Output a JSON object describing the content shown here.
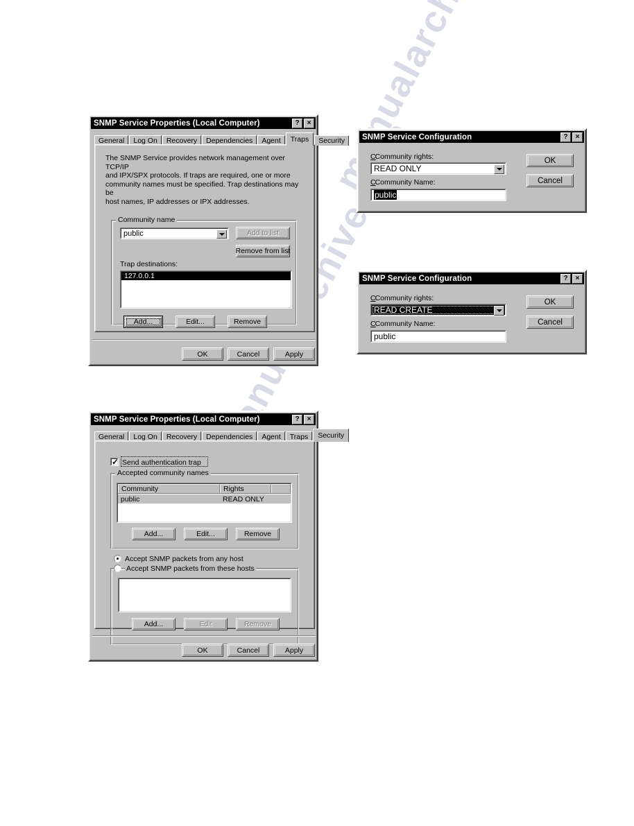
{
  "watermark": {
    "text1": "manualarchive.com",
    "text2": "manualarchive.com"
  },
  "traps_dialog": {
    "title": "SNMP Service Properties (Local Computer)",
    "titlebar_help": "?",
    "titlebar_close": "×",
    "tabs": [
      {
        "label": "General",
        "active": false
      },
      {
        "label": "Log On",
        "active": false
      },
      {
        "label": "Recovery",
        "active": false
      },
      {
        "label": "Dependencies",
        "active": false
      },
      {
        "label": "Agent",
        "active": false
      },
      {
        "label": "Traps",
        "active": true
      },
      {
        "label": "Security",
        "active": false
      }
    ],
    "description_lines": [
      "The SNMP Service provides network management over TCP/IP",
      "and IPX/SPX protocols. If traps are required, one or more",
      "community names must be specified. Trap destinations may be",
      "host names, IP addresses or IPX addresses."
    ],
    "community_group_label": "Community name",
    "community_value": "public",
    "add_to_list_label": "Add to list",
    "add_to_list_disabled": true,
    "remove_from_list_label": "Remove from list",
    "trap_destinations_label": "Trap destinations:",
    "trap_destinations": [
      "127.0.0.1"
    ],
    "add_label": "Add...",
    "edit_label": "Edit...",
    "remove_label": "Remove",
    "ok_label": "OK",
    "cancel_label": "Cancel",
    "apply_label": "Apply"
  },
  "config_dialog_1": {
    "title": "SNMP Service Configuration",
    "titlebar_help": "?",
    "titlebar_close": "×",
    "community_rights_label": "Community rights:",
    "community_rights_value": "READ ONLY",
    "community_name_label": "Community Name:",
    "community_name_value": "public",
    "community_name_selected": true,
    "ok_label": "OK",
    "cancel_label": "Cancel"
  },
  "config_dialog_2": {
    "title": "SNMP Service Configuration",
    "titlebar_help": "?",
    "titlebar_close": "×",
    "community_rights_label": "Community rights:",
    "community_rights_value": "READ CREATE",
    "community_rights_focused": true,
    "community_name_label": "Community Name:",
    "community_name_value": "public",
    "ok_label": "OK",
    "cancel_label": "Cancel"
  },
  "security_dialog": {
    "title": "SNMP Service Properties (Local Computer)",
    "titlebar_help": "?",
    "titlebar_close": "×",
    "tabs": [
      {
        "label": "General",
        "active": false
      },
      {
        "label": "Log On",
        "active": false
      },
      {
        "label": "Recovery",
        "active": false
      },
      {
        "label": "Dependencies",
        "active": false
      },
      {
        "label": "Agent",
        "active": false
      },
      {
        "label": "Traps",
        "active": false
      },
      {
        "label": "Security",
        "active": true
      }
    ],
    "send_auth_trap_label": "Send authentication trap",
    "send_auth_trap_checked": true,
    "accepted_group_label": "Accepted community names",
    "columns": [
      "Community",
      "Rights"
    ],
    "rows": [
      {
        "community": "public",
        "rights": "READ ONLY",
        "selected": true
      }
    ],
    "add_label": "Add...",
    "edit_label": "Edit...",
    "remove_label": "Remove",
    "accept_any_label": "Accept SNMP packets from any host",
    "accept_any_selected": true,
    "accept_these_label": "Accept SNMP packets from these hosts",
    "accept_these_selected": false,
    "hosts": [],
    "hosts_add_label": "Add...",
    "hosts_edit_label": "Edit",
    "hosts_edit_disabled": true,
    "hosts_remove_label": "Remove",
    "hosts_remove_disabled": true,
    "ok_label": "OK",
    "cancel_label": "Cancel",
    "apply_label": "Apply"
  }
}
